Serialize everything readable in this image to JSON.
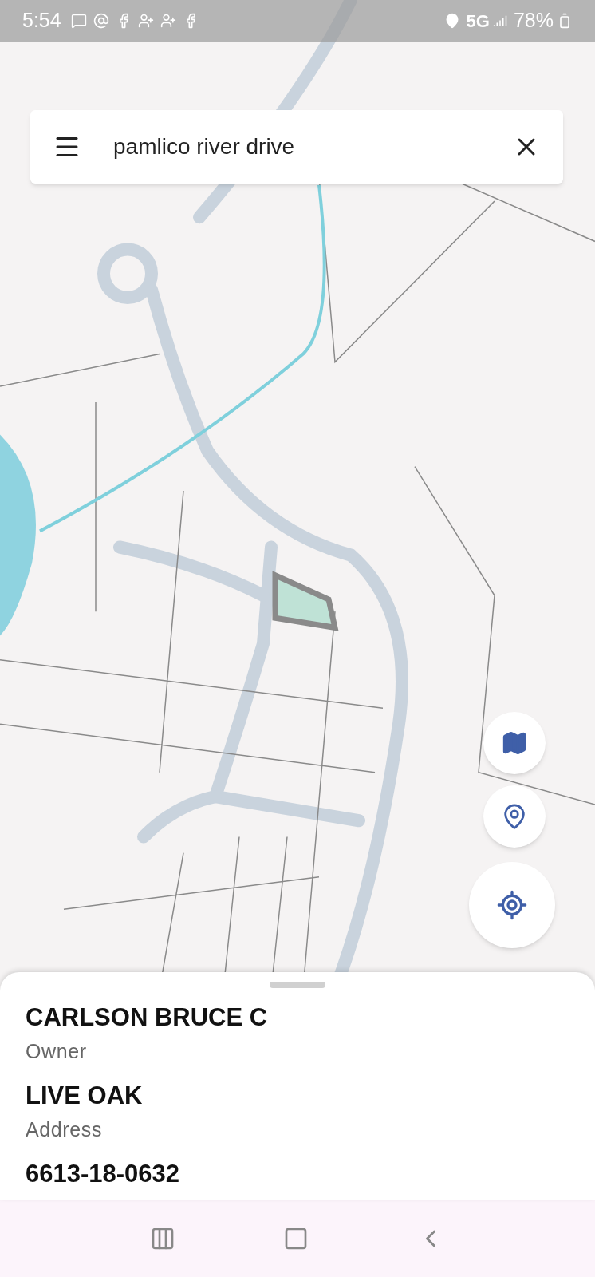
{
  "status_bar": {
    "time": "5:54",
    "network": "5G",
    "battery": "78%"
  },
  "search": {
    "value": "pamlico river drive"
  },
  "sheet": {
    "fields": [
      {
        "value": "CARLSON BRUCE C",
        "label": "Owner"
      },
      {
        "value": "LIVE OAK",
        "label": "Address"
      },
      {
        "value": "6613-18-0632"
      }
    ]
  }
}
